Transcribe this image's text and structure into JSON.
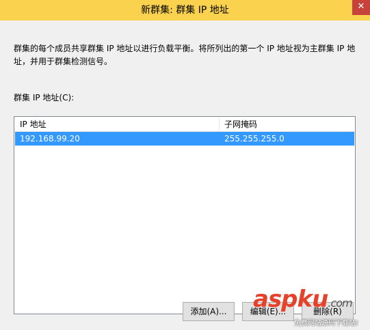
{
  "window": {
    "title": "新群集: 群集 IP 地址",
    "close_glyph": "✕"
  },
  "description": "群集的每个成员共享群集 IP 地址以进行负载平衡。将所列出的第一个 IP 地址视为主群集 IP 地址，并用于群集检测信号。",
  "list": {
    "label": "群集 IP 地址(C):",
    "columns": [
      "IP 地址",
      "子网掩码"
    ],
    "rows": [
      {
        "ip": "192.168.99.20",
        "mask": "255.255.255.0",
        "selected": true
      }
    ]
  },
  "buttons": {
    "add": "添加(A)...",
    "edit": "编辑(E)...",
    "remove": "删除(R)"
  },
  "colors": {
    "titlebar": "#fbd24e",
    "selection": "#3399ff",
    "close": "#c7423a"
  },
  "watermark": {
    "brand_a": "asp",
    "brand_b": "ku",
    "brand_c": ".com",
    "sub": "免费网站源码下载站!"
  }
}
